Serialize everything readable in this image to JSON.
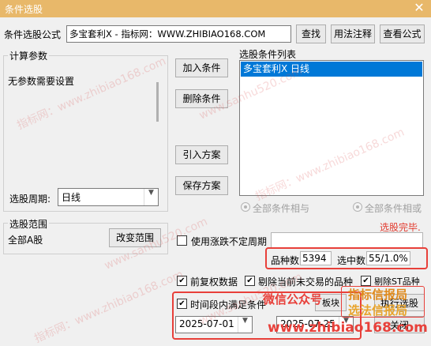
{
  "window": {
    "title": "条件选股",
    "close_glyph": "✕"
  },
  "formula": {
    "label": "条件选股公式",
    "value": "多宝套利X  - 指标网：WWW.ZHIBIAO168.COM",
    "buttons": {
      "find": "查找",
      "usage": "用法注释",
      "view": "查看公式"
    }
  },
  "params": {
    "title": "计算参数",
    "note": "无参数需要设置",
    "period_label": "选股周期:",
    "period_value": "日线"
  },
  "condition_buttons": {
    "add": "加入条件",
    "delete": "删除条件",
    "import": "引入方案",
    "save": "保存方案"
  },
  "condition_list": {
    "title": "选股条件列表",
    "items": [
      "多宝套利X  日线"
    ]
  },
  "logic": {
    "and_label": "全部条件相与",
    "or_label": "全部条件相或"
  },
  "status": {
    "message": "选股完毕."
  },
  "range": {
    "title": "选股范围",
    "value": "全部A股",
    "change_button": "改变范围"
  },
  "irregular": {
    "label": "使用涨跌不定周期"
  },
  "counts": {
    "total_label": "品种数",
    "total_value": "5394",
    "selected_label": "选中数",
    "selected_value": "55/1.0%"
  },
  "options": {
    "fq": "前复权数据",
    "untraded": "剔除当前未交易的品种",
    "st": "剔除ST品种",
    "time_condition": "时间段内满足条件",
    "board_button": "板块",
    "execute_button": "执行选股",
    "close_button": "关闭",
    "start_date": "2025-07-01",
    "end_date": "2025-07-25"
  },
  "overlay": {
    "wechat": "微信公众号",
    "site": "www.zhibiao168.com",
    "stamp_line1": "指标信报局",
    "stamp_line2": "选法信报局"
  },
  "watermarks": [
    "指标网：www.zhibiao168.com",
    "www.sanhu520.com",
    "指标网：www.zhibiao168.com",
    "www.sanhu520.com",
    "指标网：www.zhibiao168.com",
    "www.sanhu520.com"
  ],
  "icons": {
    "combo_arrow": "chevron-down-icon",
    "check": "checkmark-icon",
    "radio": "radio-icon"
  }
}
